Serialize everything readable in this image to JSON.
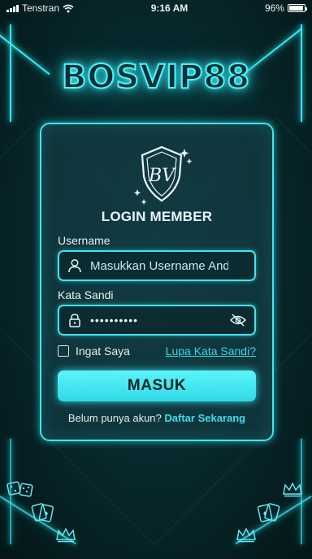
{
  "status_bar": {
    "carrier": "Tenstran",
    "time": "9:16 AM",
    "battery": "96%",
    "battery_level": 0.96
  },
  "brand": {
    "title": "BOSVIP88"
  },
  "login": {
    "logo_text": "BV",
    "title": "LOGIN MEMBER",
    "username_label": "Username",
    "username_placeholder": "Masukkan Username Anda",
    "password_label": "Kata Sandi",
    "password_mask": "••••••••••",
    "remember_label": "Ingat Saya",
    "forgot_link": "Lupa Kata Sandi?",
    "submit_label": "MASUK",
    "register_prompt": "Belum punya akun?",
    "register_link": "Daftar Sekarang"
  },
  "icons": {
    "signal": "signal-icon",
    "wifi": "wifi-icon",
    "user": "user-icon",
    "lock": "lock-icon",
    "eye_off": "eye-off-icon",
    "shield": "shield-logo-icon",
    "dice": "dice-icon",
    "cards": "playing-cards-icon",
    "crown": "crown-icon"
  },
  "colors": {
    "accent": "#35e6f0",
    "background": "#062024",
    "card_bg": "#143c42",
    "button_text": "#0a2326"
  }
}
